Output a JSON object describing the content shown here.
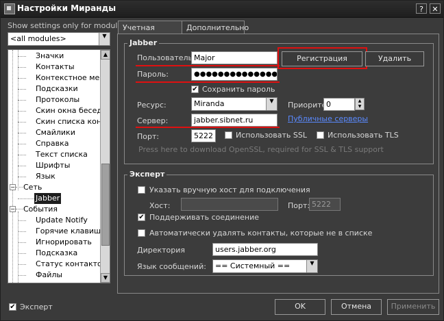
{
  "window": {
    "title": "Настройки Миранды",
    "help_btn": "?",
    "close_btn": "✕"
  },
  "sidebar": {
    "module_label": "Show settings only for module:",
    "module_value": "<all modules>",
    "tree": [
      {
        "label": "Значки"
      },
      {
        "label": "Контакты"
      },
      {
        "label": "Контекстное меню"
      },
      {
        "label": "Подсказки"
      },
      {
        "label": "Протоколы"
      },
      {
        "label": "Скин окна беседы"
      },
      {
        "label": "Скин списка контактов"
      },
      {
        "label": "Смайлики"
      },
      {
        "label": "Справка"
      },
      {
        "label": "Текст списка"
      },
      {
        "label": "Шрифты"
      },
      {
        "label": "Язык"
      },
      {
        "label": "Сеть"
      },
      {
        "label": "Jabber"
      },
      {
        "label": "События"
      },
      {
        "label": "Update Notify"
      },
      {
        "label": "Горячие клавиши"
      },
      {
        "label": "Игнорировать"
      },
      {
        "label": "Подсказка"
      },
      {
        "label": "Статус контактов"
      },
      {
        "label": "Файлы"
      }
    ],
    "expert_label": "Эксперт",
    "expert_checked": true
  },
  "tabs": [
    {
      "label": "Учетная запись"
    },
    {
      "label": "Дополнительно"
    }
  ],
  "jabber": {
    "title": "Jabber",
    "user_label": "Пользователь:",
    "user_value": "Major",
    "password_label": "Пароль:",
    "password_value": "●●●●●●●●●●●●●●●",
    "register_btn": "Регистрация",
    "delete_btn": "Удалить",
    "save_password_label": "Сохранить пароль",
    "resource_label": "Ресурс:",
    "resource_value": "Miranda",
    "priority_label": "Приорите",
    "priority_value": "0",
    "server_label": "Сервер:",
    "server_value": "jabber.sibnet.ru",
    "public_servers_link": "Публичные серверы",
    "port_label": "Порт:",
    "port_value": "5222",
    "ssl_label": "Использовать SSL",
    "tls_label": "Использовать TLS",
    "openssl_hint": "Press here to download OpenSSL, required for SSL & TLS support"
  },
  "expert": {
    "title": "Эксперт",
    "manual_host_label": "Указать вручную хост для подключения",
    "host_label": "Хост:",
    "host_value": "",
    "port_label": "Порт:",
    "port_value": "5222",
    "keepalive_label": "Поддерживать соединение",
    "auto_delete_label": "Автоматически удалять контакты, которые не в списке",
    "directory_label": "Директория",
    "directory_value": "users.jabber.org",
    "msg_lang_label": "Язык сообщений:",
    "msg_lang_value": "== Системный =="
  },
  "footer": {
    "ok": "OK",
    "cancel": "Отмена",
    "apply": "Применить"
  },
  "accent": {
    "highlight": "#e01010",
    "link": "#5a8aff"
  }
}
